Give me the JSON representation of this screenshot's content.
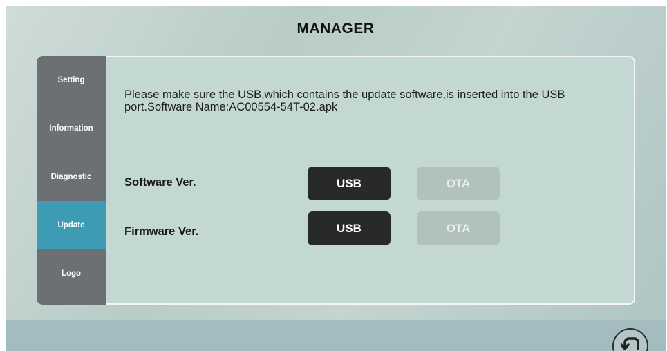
{
  "header": {
    "title": "MANAGER"
  },
  "sidebar": {
    "items": [
      {
        "label": "Setting",
        "active": false
      },
      {
        "label": "Information",
        "active": false
      },
      {
        "label": "Diagnostic",
        "active": false
      },
      {
        "label": "Update",
        "active": true
      },
      {
        "label": "Logo",
        "active": false
      }
    ]
  },
  "main": {
    "notice": "Please make sure the USB,which contains the update software,is inserted into the USB port.Software Name:AC00554-54T-02.apk",
    "rows": [
      {
        "label": "Software Ver.",
        "usb_label": "USB",
        "ota_label": "OTA"
      },
      {
        "label": "Firmware Ver.",
        "usb_label": "USB",
        "ota_label": "OTA"
      }
    ]
  },
  "footer": {
    "back_icon": "back-arrow-icon"
  },
  "colors": {
    "active_tab": "#3d9cb4",
    "sidebar": "#6d7072",
    "usb_button": "#27292b",
    "ota_button_disabled": "#b0c1be"
  }
}
